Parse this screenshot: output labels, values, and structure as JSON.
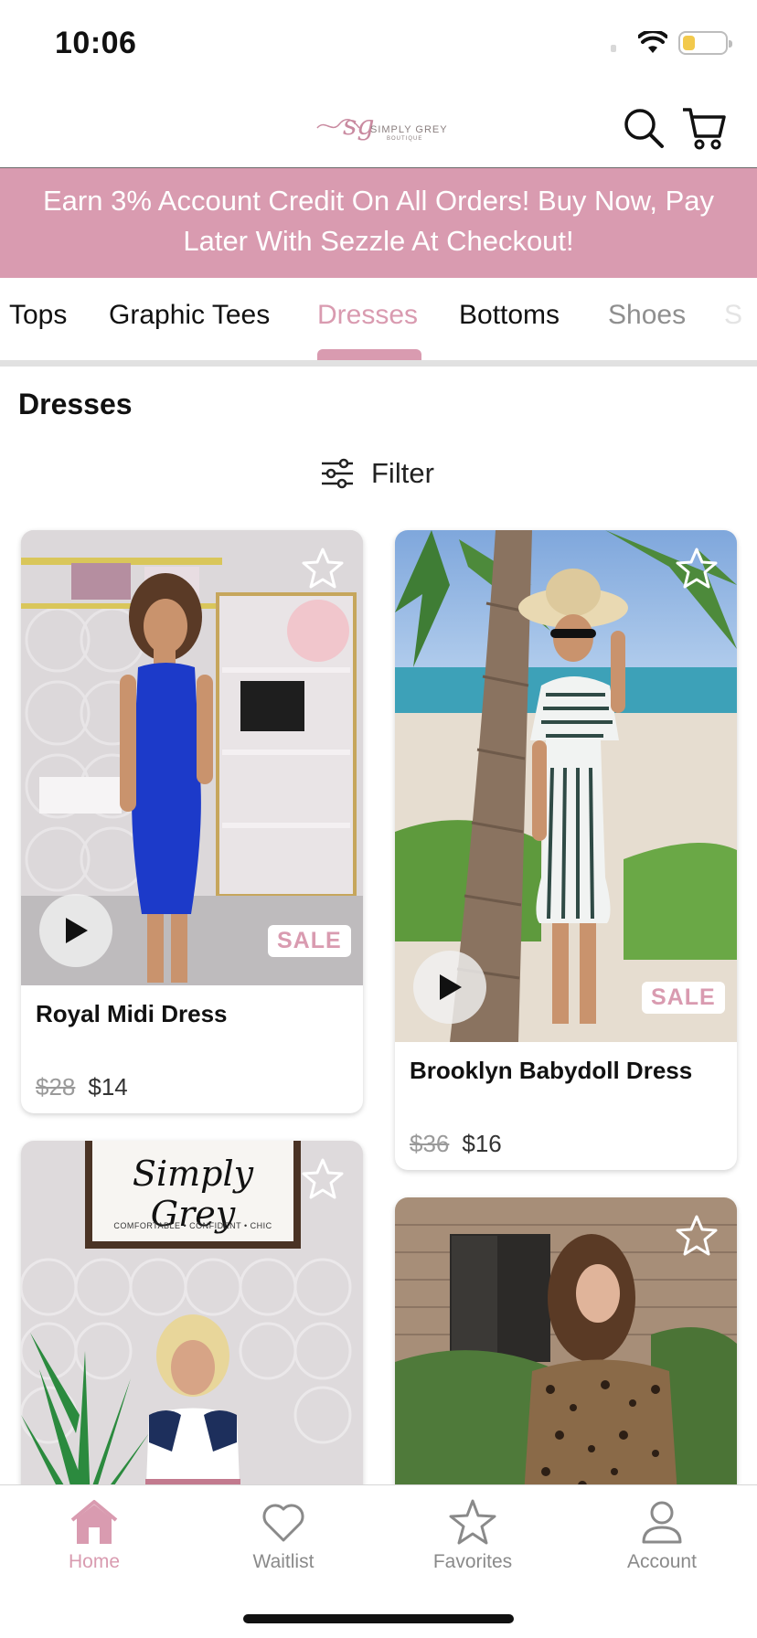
{
  "status_bar": {
    "time": "10:06"
  },
  "header": {
    "logo_monogram": "sg",
    "logo_text": "SIMPLY GREY",
    "logo_subtext": "BOUTIQUE",
    "search_icon": "search-icon",
    "cart_icon": "cart-icon"
  },
  "promo": {
    "text": "Earn 3% Account Credit On All Orders! Buy Now, Pay Later With Sezzle At Checkout!"
  },
  "categories": {
    "tabs": [
      {
        "label": "Tops"
      },
      {
        "label": "Graphic Tees"
      },
      {
        "label": "Dresses",
        "active": true
      },
      {
        "label": "Bottoms"
      },
      {
        "label": "Shoes"
      },
      {
        "label": "S"
      }
    ]
  },
  "section": {
    "title": "Dresses",
    "filter_label": "Filter"
  },
  "products": [
    {
      "name": "Royal Midi Dress",
      "old_price": "$28",
      "price": "$14",
      "badge": "SALE"
    },
    {
      "name": "Brooklyn Babydoll Dress",
      "old_price": "$36",
      "price": "$16",
      "badge": "SALE"
    },
    {
      "image_sign_text": "Simply Grey",
      "image_sign_subtext": "COMFORTABLE • CONFIDENT • CHIC"
    },
    {}
  ],
  "tabbar": {
    "items": [
      {
        "label": "Home",
        "icon": "home-icon",
        "active": true
      },
      {
        "label": "Waitlist",
        "icon": "heart-icon"
      },
      {
        "label": "Favorites",
        "icon": "star-icon"
      },
      {
        "label": "Account",
        "icon": "person-icon"
      }
    ]
  },
  "colors": {
    "accent_pink": "#d99bb0",
    "sale_pink": "#d99bb0",
    "battery_yellow": "#f2c94c"
  }
}
